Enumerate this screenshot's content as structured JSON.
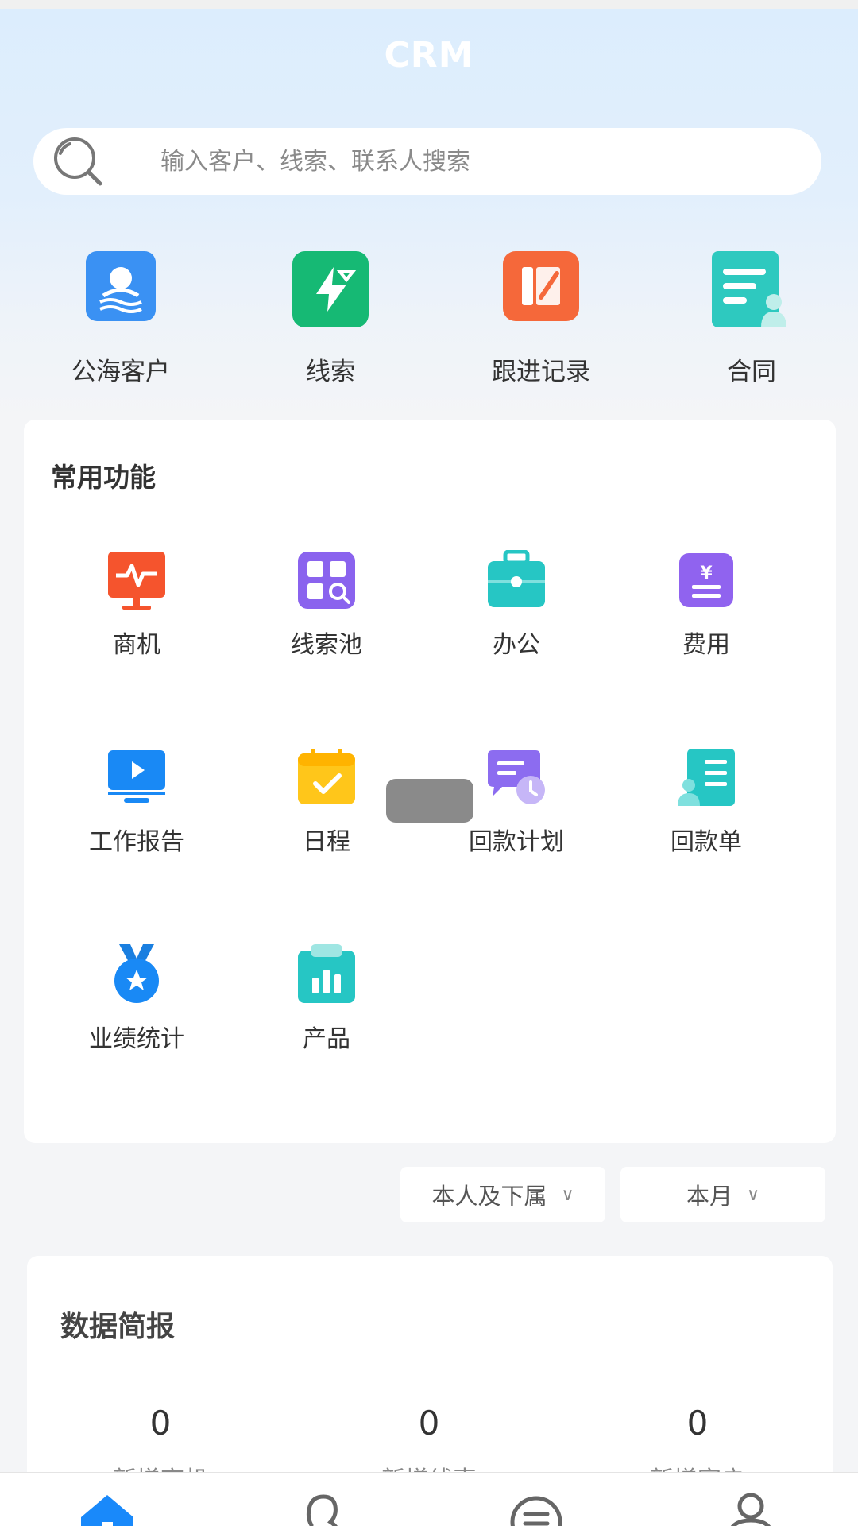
{
  "header": {
    "title": "CRM"
  },
  "search": {
    "placeholder": "输入客户、线索、联系人搜索"
  },
  "quick_nav": [
    {
      "label": "公海客户",
      "icon": "sea-customer-icon"
    },
    {
      "label": "线索",
      "icon": "lightning-icon"
    },
    {
      "label": "跟进记录",
      "icon": "follow-record-icon"
    },
    {
      "label": "合同",
      "icon": "contract-icon"
    }
  ],
  "common": {
    "title": "常用功能",
    "items": [
      {
        "label": "商机",
        "icon": "monitor-pulse-icon"
      },
      {
        "label": "线索池",
        "icon": "grid-search-icon"
      },
      {
        "label": "办公",
        "icon": "briefcase-icon"
      },
      {
        "label": "费用",
        "icon": "yen-icon"
      },
      {
        "label": "工作报告",
        "icon": "screen-play-icon"
      },
      {
        "label": "日程",
        "icon": "calendar-check-icon"
      },
      {
        "label": "回款计划",
        "icon": "chat-clock-icon"
      },
      {
        "label": "回款单",
        "icon": "person-doc-icon"
      },
      {
        "label": "业绩统计",
        "icon": "medal-icon"
      },
      {
        "label": "产品",
        "icon": "bar-box-icon"
      }
    ]
  },
  "filters": {
    "scope": "本人及下属",
    "period": "本月"
  },
  "report": {
    "title": "数据简报",
    "stats": [
      {
        "value": "0",
        "label": "新增商机"
      },
      {
        "value": "0",
        "label": "新增线索"
      },
      {
        "value": "0",
        "label": "新增客户"
      }
    ]
  },
  "tabbar": [
    {
      "icon": "home-icon"
    },
    {
      "icon": "contacts-icon"
    },
    {
      "icon": "message-icon"
    },
    {
      "icon": "profile-icon"
    }
  ],
  "colors": {
    "accent": "#1989fa",
    "header_bg": "#dcedfd"
  }
}
